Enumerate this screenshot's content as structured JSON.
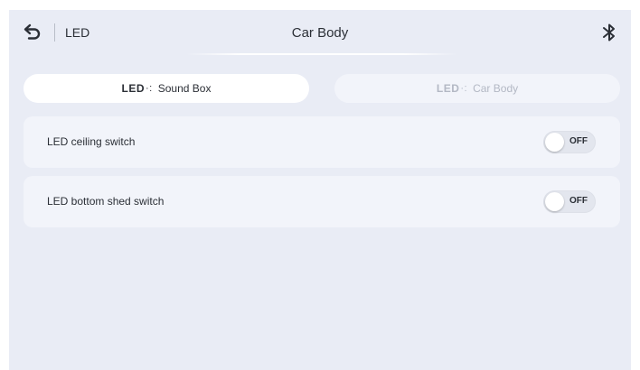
{
  "header": {
    "back_icon": "back-arrow-icon",
    "section_title": "LED",
    "page_title": "Car Body",
    "bluetooth_icon": "bluetooth-icon"
  },
  "tabs": [
    {
      "icon_text": "LED",
      "icon": "led-light-icon",
      "label": "Sound Box",
      "active": true
    },
    {
      "icon_text": "LED",
      "icon": "led-light-icon",
      "label": "Car Body",
      "active": false
    }
  ],
  "settings": [
    {
      "label": "LED ceiling switch",
      "state_text": "OFF",
      "on": false
    },
    {
      "label": "LED bottom shed switch",
      "state_text": "OFF",
      "on": false
    }
  ],
  "colors": {
    "background": "#e9ecf5",
    "panel": "#f2f4fa",
    "active_tab": "#ffffff",
    "text": "#2b2f36",
    "inactive_text": "#b3b8c4"
  }
}
